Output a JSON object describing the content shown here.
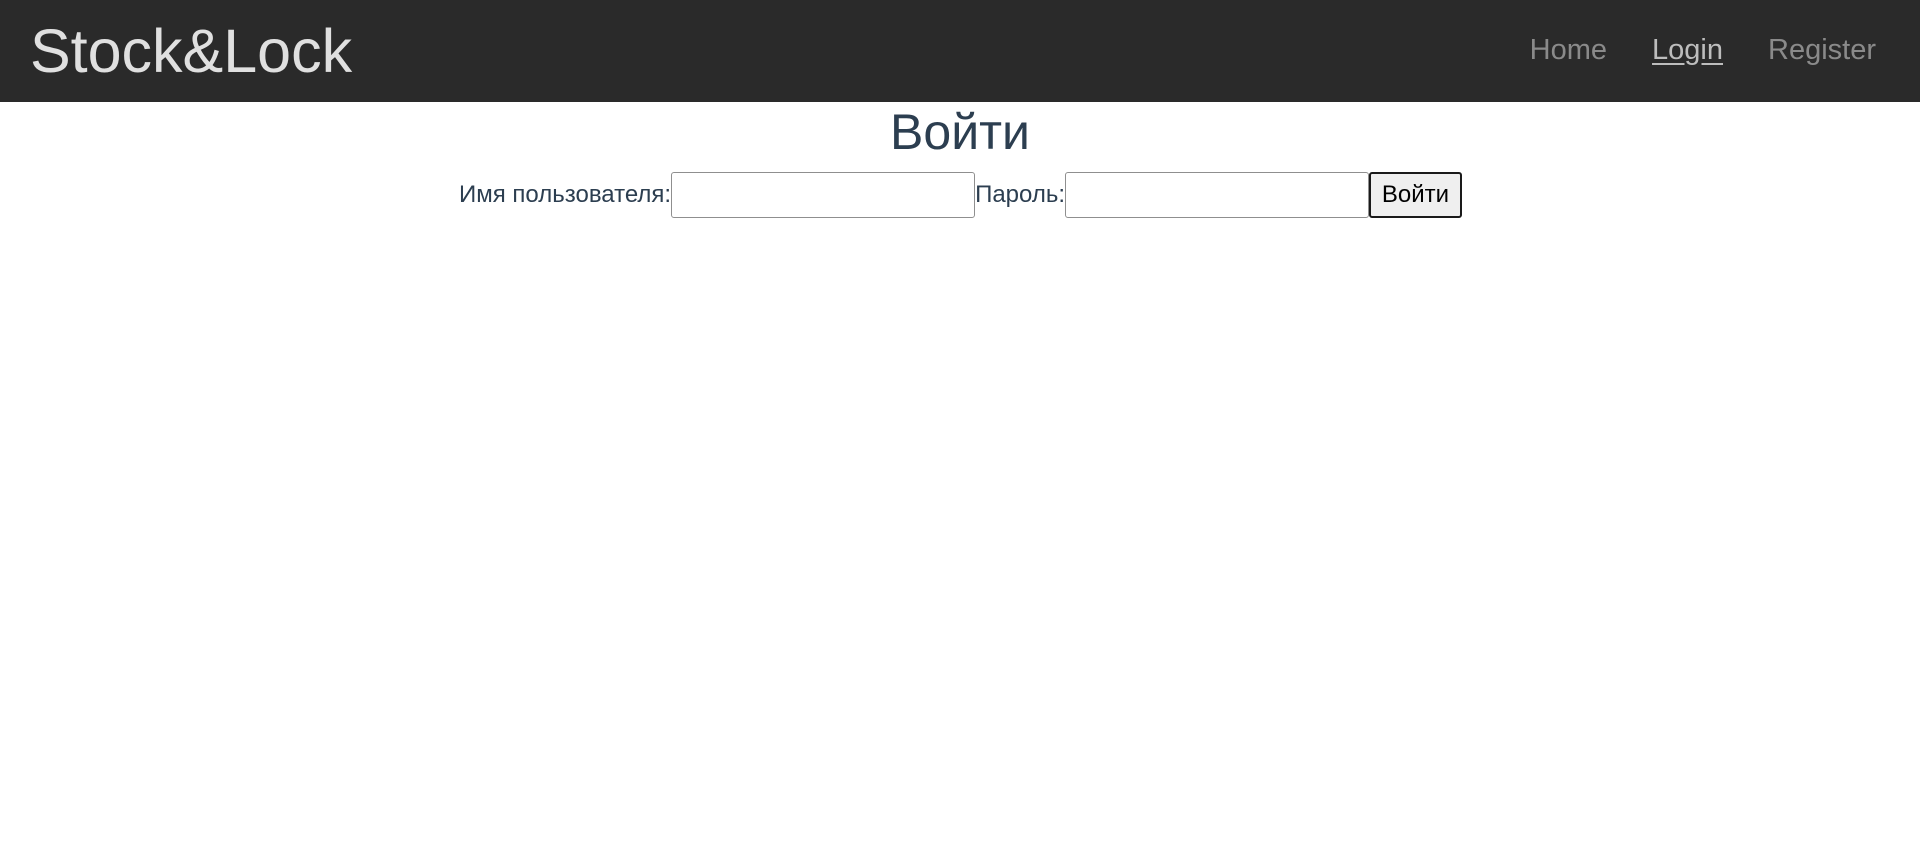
{
  "navbar": {
    "brand": "Stock&Lock",
    "links": [
      {
        "label": "Home",
        "active": false
      },
      {
        "label": "Login",
        "active": true
      },
      {
        "label": "Register",
        "active": false
      }
    ]
  },
  "page": {
    "title": "Войти"
  },
  "login_form": {
    "username_label": "Имя пользователя:",
    "username_value": "",
    "password_label": "Пароль:",
    "password_value": "",
    "submit_label": "Войти"
  },
  "colors": {
    "navbar_bg": "#2a2a2a",
    "brand_text": "#e0e0e0",
    "nav_link": "#8a8a8a",
    "nav_link_active": "#bdbdbd",
    "heading_text": "#2c3e50"
  }
}
